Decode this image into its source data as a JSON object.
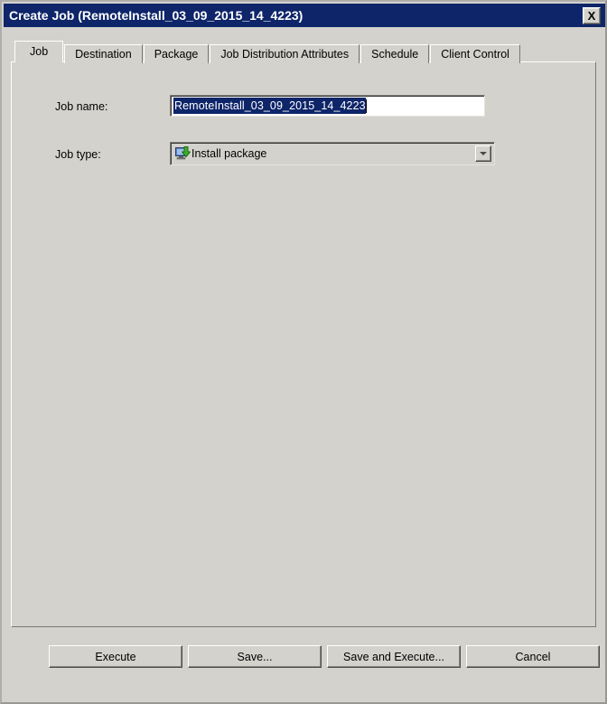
{
  "window": {
    "title": "Create Job (RemoteInstall_03_09_2015_14_4223)",
    "close_label": "X",
    "close_icon": "close-icon",
    "titlebar_color": "#0e2569",
    "face_color": "#d4d2cd"
  },
  "tabs": [
    {
      "label": "Job",
      "active": true
    },
    {
      "label": "Destination",
      "active": false
    },
    {
      "label": "Package",
      "active": false
    },
    {
      "label": "Job Distribution Attributes",
      "active": false
    },
    {
      "label": "Schedule",
      "active": false
    },
    {
      "label": "Client Control",
      "active": false
    }
  ],
  "job_tab": {
    "job_name": {
      "label": "Job name:",
      "value": "RemoteInstall_03_09_2015_14_4223",
      "placeholder": "",
      "selected": true
    },
    "job_type": {
      "label": "Job type:",
      "value": "Install package",
      "icon": "install-package-icon",
      "dropdown_icon": "chevron-down-icon"
    }
  },
  "buttons": [
    {
      "id": "execute",
      "label": "Execute"
    },
    {
      "id": "save",
      "label": "Save..."
    },
    {
      "id": "save_and_execute",
      "label": "Save and Execute..."
    },
    {
      "id": "cancel",
      "label": "Cancel"
    }
  ]
}
